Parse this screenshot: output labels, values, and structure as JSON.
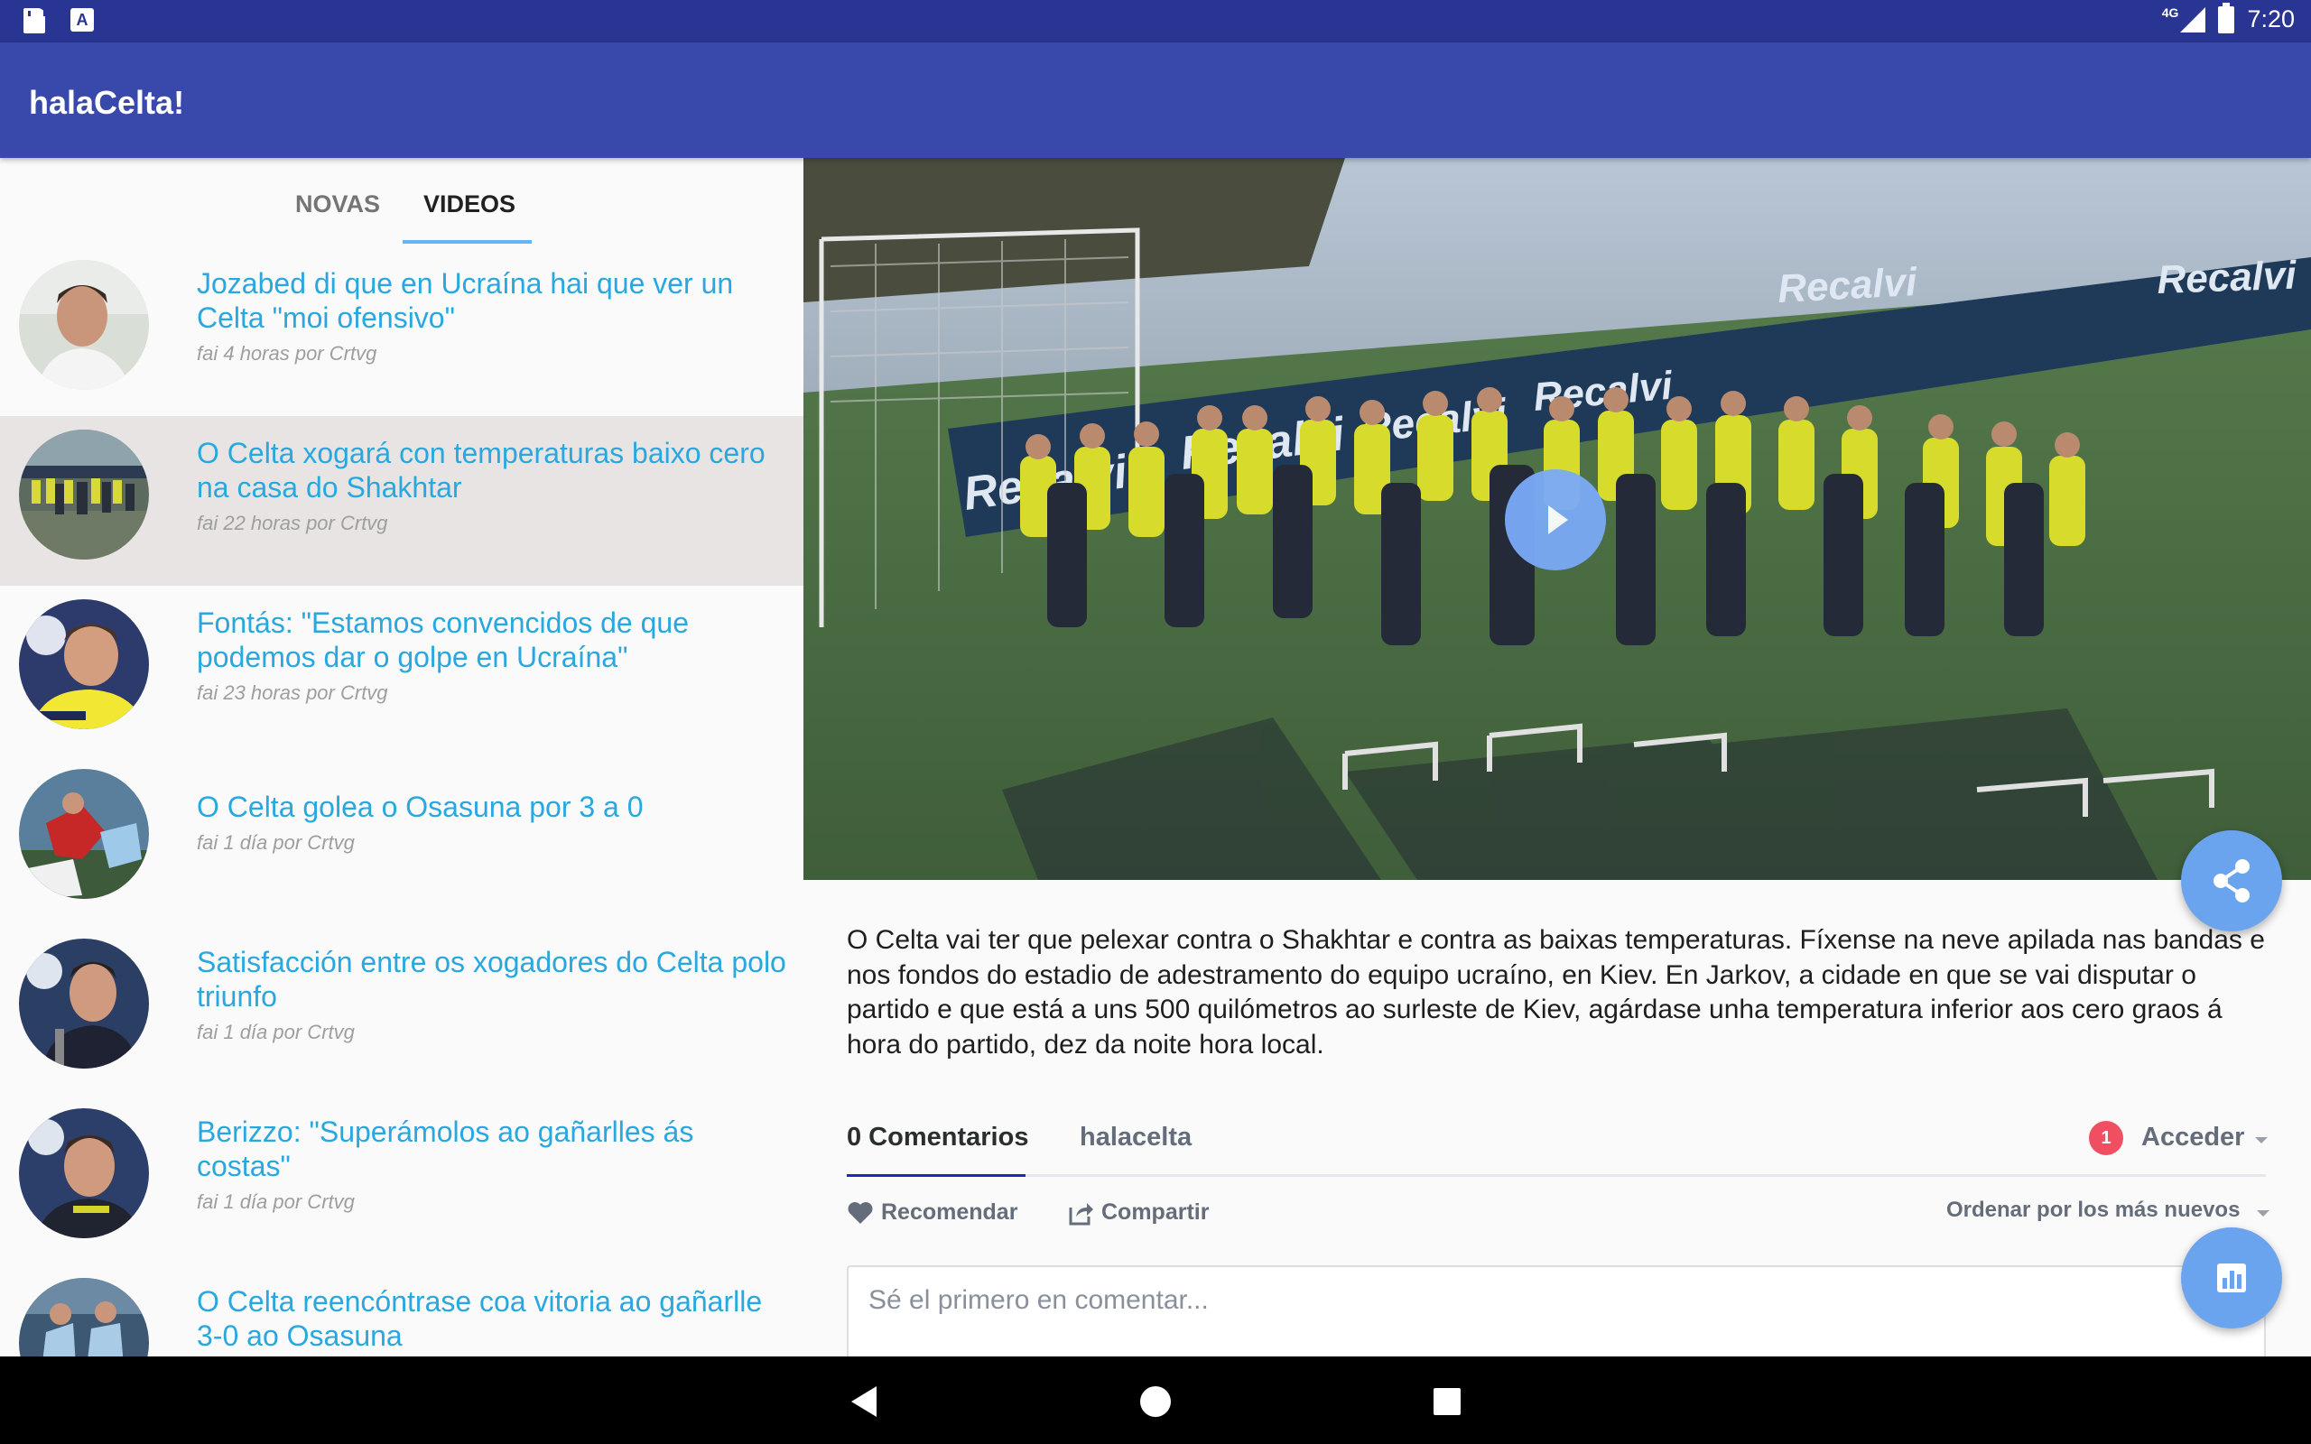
{
  "status_bar": {
    "network": "4G",
    "time": "7:20",
    "icons": [
      "sd-card-icon",
      "text-a-icon",
      "signal-icon",
      "battery-icon"
    ]
  },
  "app_bar": {
    "title": "halaCelta!"
  },
  "tabs": [
    {
      "label": "NOVAS",
      "selected": false
    },
    {
      "label": "VIDEOS",
      "selected": true
    }
  ],
  "videos": [
    {
      "title": "Jozabed di que en Ucraína hai que ver un Celta \"moi ofensivo\"",
      "meta": "fai 4 horas por Crtvg"
    },
    {
      "title": "O Celta xogará con temperaturas baixo cero na casa do Shakhtar",
      "meta": "fai 22 horas por Crtvg"
    },
    {
      "title": "Fontás: \"Estamos convencidos de que podemos dar o golpe en Ucraína\"",
      "meta": "fai 23 horas por Crtvg"
    },
    {
      "title": "O Celta golea o Osasuna por 3 a 0",
      "meta": "fai 1 día por Crtvg"
    },
    {
      "title": "Satisfacción entre os xogadores do Celta polo triunfo",
      "meta": "fai 1 día por Crtvg"
    },
    {
      "title": "Berizzo: \"Superámolos ao gañarlles ás costas\"",
      "meta": "fai 1 día por Crtvg"
    },
    {
      "title": "O Celta reencóntrase coa vitoria ao gañarlle 3-0 ao Osasuna",
      "meta": ""
    }
  ],
  "detail": {
    "banner_text": "Recalvi",
    "description": "O Celta vai ter que pelexar contra o Shakhtar e contra as baixas temperaturas. Fíxense na neve apilada nas bandas e nos fondos do estadio de adestramento do equipo ucraíno, en Kiev. En Jarkov, a cidade en que se vai disputar o partido e que está a uns 500 quilómetros ao surleste de Kiev, agárdase unha temperatura inferior aos cero graos á hora do partido, dez da noite hora local."
  },
  "comments": {
    "count_label": "0 Comentarios",
    "site_label": "halacelta",
    "badge": "1",
    "login_label": "Acceder",
    "recommend_label": "Recomendar",
    "share_label": "Compartir",
    "sort_label": "Ordenar por los más nuevos",
    "placeholder": "Sé el primero en comentar..."
  },
  "colors": {
    "status_bar": "#283593",
    "app_bar": "#3949ab",
    "link": "#29a8e0",
    "fab": "#6aa3ee",
    "badge": "#ef4f60"
  }
}
